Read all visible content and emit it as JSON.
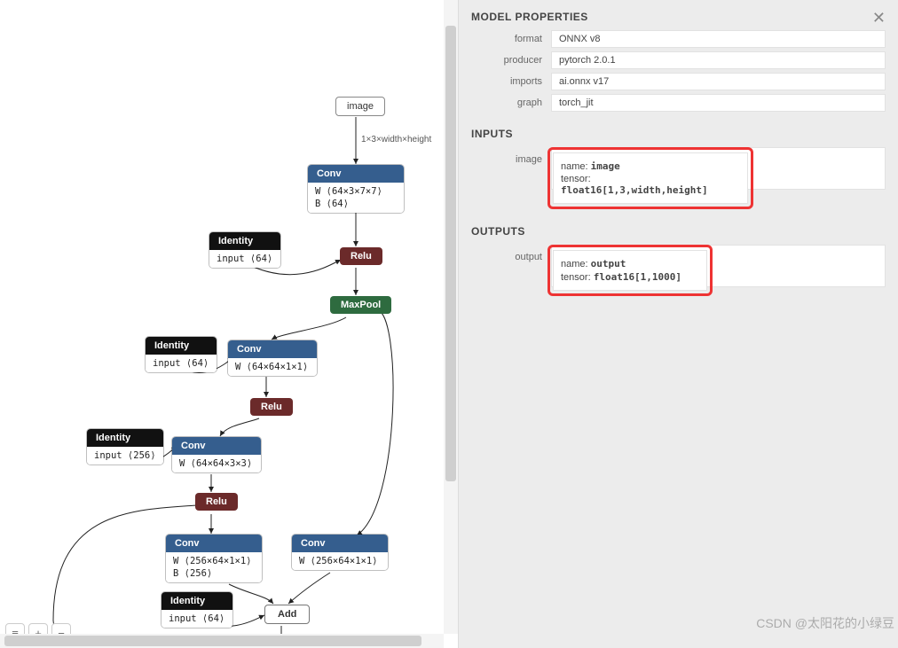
{
  "sidebar": {
    "title": "MODEL PROPERTIES",
    "sections": {
      "inputs_title": "INPUTS",
      "outputs_title": "OUTPUTS"
    },
    "props": {
      "format": {
        "label": "format",
        "value": "ONNX v8"
      },
      "producer": {
        "label": "producer",
        "value": "pytorch 2.0.1"
      },
      "imports": {
        "label": "imports",
        "value": "ai.onnx v17"
      },
      "graph": {
        "label": "graph",
        "value": "torch_jit"
      }
    },
    "inputs": {
      "image": {
        "label": "image",
        "name_key": "name:",
        "name_val": "image",
        "tensor_key": "tensor:",
        "tensor_val": "float16[1,3,width,height]"
      }
    },
    "outputs": {
      "output": {
        "label": "output",
        "name_key": "name:",
        "name_val": "output",
        "tensor_key": "tensor:",
        "tensor_val": "float16[1,1000]"
      }
    }
  },
  "graph": {
    "edge_label": "1×3×width×height",
    "nodes": {
      "image": {
        "label": "image"
      },
      "conv1": {
        "title": "Conv",
        "w": "W ⟨64×3×7×7⟩",
        "b": "B ⟨64⟩"
      },
      "relu1": {
        "label": "Relu"
      },
      "maxpool": {
        "label": "MaxPool"
      },
      "id1": {
        "title": "Identity",
        "line": "input ⟨64⟩"
      },
      "conv2": {
        "title": "Conv",
        "w": "W ⟨64×64×1×1⟩"
      },
      "id2": {
        "title": "Identity",
        "line": "input ⟨64⟩"
      },
      "relu2": {
        "label": "Relu"
      },
      "conv3": {
        "title": "Conv",
        "w": "W ⟨64×64×3×3⟩"
      },
      "id3": {
        "title": "Identity",
        "line": "input ⟨256⟩"
      },
      "relu3": {
        "label": "Relu"
      },
      "conv4": {
        "title": "Conv",
        "w": "W ⟨256×64×1×1⟩",
        "b": "B ⟨256⟩"
      },
      "conv5": {
        "title": "Conv",
        "w": "W ⟨256×64×1×1⟩"
      },
      "add": {
        "label": "Add"
      },
      "id4": {
        "title": "Identity",
        "line": "input ⟨64⟩"
      }
    }
  },
  "watermark": "CSDN @太阳花的小绿豆",
  "icons": {
    "zoom_in": "+",
    "zoom_out": "−",
    "menu": "≡"
  }
}
